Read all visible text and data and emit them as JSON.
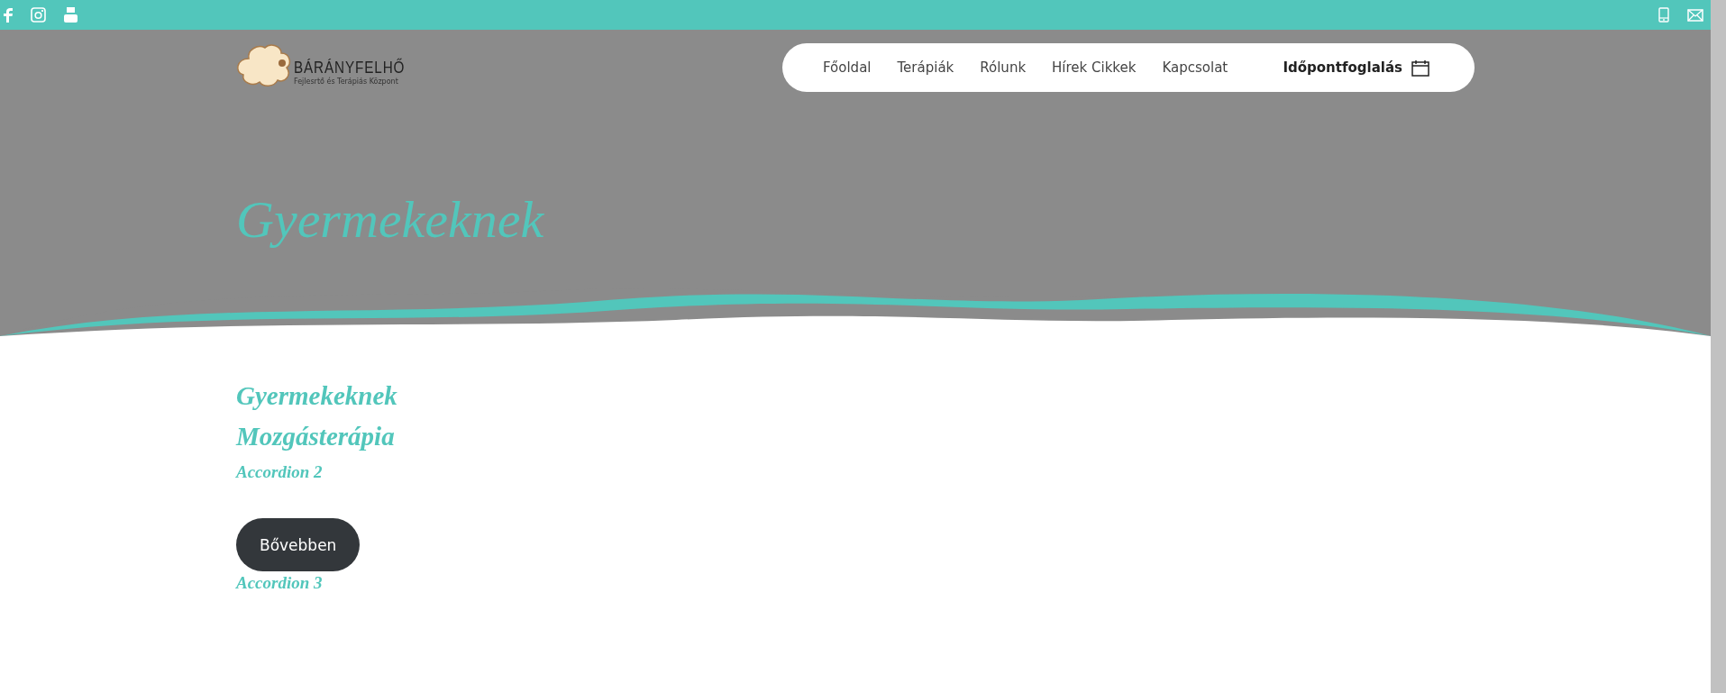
{
  "logo": {
    "name": "BÁRÁNYFELHŐ",
    "tagline": "Fejlesrtő és Terápiás Központ"
  },
  "nav": {
    "items": [
      "Főoldal",
      "Terápiák",
      "Rólunk",
      "Hírek Cikkek",
      "Kapcsolat"
    ],
    "booking": "Időpontfoglalás"
  },
  "hero": {
    "title": "Gyermekeknek"
  },
  "content": {
    "headings": [
      "Gyermekeknek",
      "Mozgásterápia"
    ],
    "accordion_2": "Accordion 2",
    "button": "Bővebben",
    "accordion_3": "Accordion 3"
  }
}
